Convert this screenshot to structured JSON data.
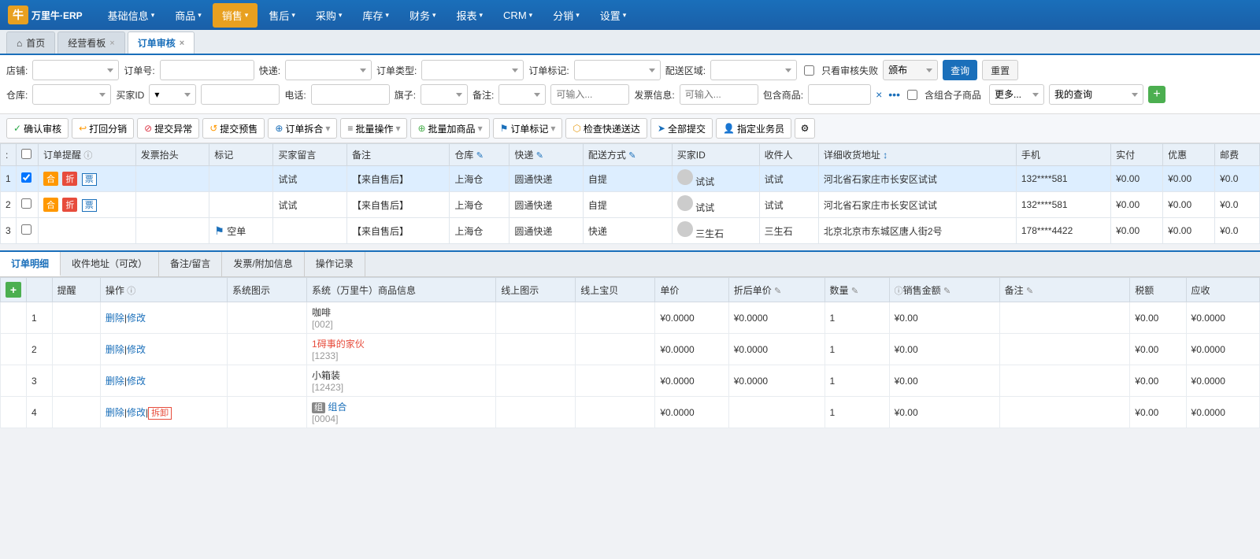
{
  "app": {
    "logo_text": "万里牛·ERP"
  },
  "nav": {
    "items": [
      {
        "label": "基础信息",
        "has_arrow": true,
        "active": false
      },
      {
        "label": "商品",
        "has_arrow": true,
        "active": false
      },
      {
        "label": "销售",
        "has_arrow": true,
        "active": true
      },
      {
        "label": "售后",
        "has_arrow": true,
        "active": false
      },
      {
        "label": "采购",
        "has_arrow": true,
        "active": false
      },
      {
        "label": "库存",
        "has_arrow": true,
        "active": false
      },
      {
        "label": "财务",
        "has_arrow": true,
        "active": false
      },
      {
        "label": "报表",
        "has_arrow": true,
        "active": false
      },
      {
        "label": "CRM",
        "has_arrow": true,
        "active": false
      },
      {
        "label": "分销",
        "has_arrow": true,
        "active": false
      },
      {
        "label": "设置",
        "has_arrow": true,
        "active": false
      }
    ]
  },
  "tabs": [
    {
      "label": "首页",
      "closable": false,
      "icon": "home"
    },
    {
      "label": "经营看板",
      "closable": true
    },
    {
      "label": "订单审核",
      "closable": true,
      "active": true
    }
  ],
  "filters": {
    "row1": {
      "store_label": "店铺:",
      "order_no_label": "订单号:",
      "express_label": "快递:",
      "order_type_label": "订单类型:",
      "order_mark_label": "订单标记:",
      "delivery_area_label": "配送区域:",
      "only_failed_label": "只看审核失败",
      "search_btn": "查询",
      "reset_btn": "重置"
    },
    "row2": {
      "warehouse_label": "仓库:",
      "buyer_id_label": "买家ID",
      "phone_label": "电话:",
      "flag_label": "旗子:",
      "note_label": "备注:",
      "note_placeholder": "可输入...",
      "invoice_label": "发票信息:",
      "invoice_placeholder": "可输入...",
      "include_goods_label": "包含商品:",
      "combined_child_label": "含组合子商品",
      "more_btn": "更多...",
      "my_query_label": "我的查询"
    }
  },
  "toolbar": {
    "confirm_btn": "确认审核",
    "return_btn": "打回分销",
    "exception_btn": "提交异常",
    "presale_btn": "提交预售",
    "merge_btn": "订单拆合",
    "batch_op_btn": "批量操作",
    "batch_add_btn": "批量加商品",
    "order_mark_btn": "订单标记",
    "check_express_btn": "检查快递送达",
    "submit_all_btn": "全部提交",
    "assign_btn": "指定业务员"
  },
  "main_table": {
    "columns": [
      "",
      "✓",
      "订单提醒",
      "发票抬头",
      "标记",
      "买家留言",
      "备注",
      "仓库",
      "快递",
      "配送方式",
      "买家ID",
      "收件人",
      "详细收货地址",
      "手机",
      "实付",
      "优惠",
      "邮费"
    ],
    "rows": [
      {
        "seq": "1",
        "checked": true,
        "tags": [
          "合",
          "折",
          "票"
        ],
        "invoice": "",
        "mark": "",
        "buyer_msg": "试试",
        "note": "【来自售后】",
        "warehouse": "上海仓",
        "express": "圆通快递",
        "delivery": "自提",
        "buyer_id": "试试",
        "receiver": "试试",
        "address": "河北省石家庄市长安区试试",
        "mobile": "132****581",
        "paid": "¥0.00",
        "discount": "¥0.00",
        "postage": "¥0.0",
        "selected": true
      },
      {
        "seq": "2",
        "checked": false,
        "tags": [
          "合",
          "折",
          "票"
        ],
        "invoice": "",
        "mark": "",
        "buyer_msg": "试试",
        "note": "【来自售后】",
        "warehouse": "上海仓",
        "express": "圆通快递",
        "delivery": "自提",
        "buyer_id": "试试",
        "receiver": "试试",
        "address": "河北省石家庄市长安区试试",
        "mobile": "132****581",
        "paid": "¥0.00",
        "discount": "¥0.00",
        "postage": "¥0.0",
        "selected": false
      },
      {
        "seq": "3",
        "checked": false,
        "tags": [],
        "invoice": "",
        "mark": "空单",
        "mark_flag": "bookmark",
        "buyer_msg": "",
        "note": "【来自售后】",
        "warehouse": "上海仓",
        "express": "圆通快递",
        "delivery": "快递",
        "buyer_id": "三生石",
        "receiver": "三生石",
        "address": "北京北京市东城区唐人街2号",
        "mobile": "178****4422",
        "paid": "¥0.00",
        "discount": "¥0.00",
        "postage": "¥0.0",
        "selected": false
      }
    ]
  },
  "bottom_panel": {
    "tabs": [
      "订单明细",
      "收件地址（可改）",
      "备注/留言",
      "发票/附加信息",
      "操作记录"
    ],
    "active_tab": "订单明细",
    "detail_columns": [
      "",
      "提醒",
      "操作",
      "系统图示",
      "系统（万里牛）商品信息",
      "线上图示",
      "线上宝贝",
      "单价",
      "折后单价",
      "数量",
      "销售金额",
      "备注",
      "税额",
      "应收"
    ],
    "detail_rows": [
      {
        "seq": "1",
        "reminder": "",
        "ops": "删除|修改",
        "system_img": "",
        "product_name": "咖啡",
        "product_code": "[002]",
        "product_name_color": "normal",
        "online_img": "",
        "online_product": "",
        "unit_price": "¥0.0000",
        "discounted_price": "¥0.0000",
        "quantity": "1",
        "sales_amount": "¥0.00",
        "note": "",
        "tax": "¥0.00",
        "receivable": "¥0.0000"
      },
      {
        "seq": "2",
        "reminder": "",
        "ops": "删除|修改",
        "system_img": "",
        "product_name": "1碍事的家伙",
        "product_code": "[1233]",
        "product_name_color": "red",
        "online_img": "",
        "online_product": "",
        "unit_price": "¥0.0000",
        "discounted_price": "¥0.0000",
        "quantity": "1",
        "sales_amount": "¥0.00",
        "note": "",
        "tax": "¥0.00",
        "receivable": "¥0.0000"
      },
      {
        "seq": "3",
        "reminder": "",
        "ops": "删除|修改",
        "system_img": "",
        "product_name": "小箱装",
        "product_code": "[12423]",
        "product_name_color": "normal",
        "online_img": "",
        "online_product": "",
        "unit_price": "¥0.0000",
        "discounted_price": "¥0.0000",
        "quantity": "1",
        "sales_amount": "¥0.00",
        "note": "",
        "tax": "¥0.00",
        "receivable": "¥0.0000"
      },
      {
        "seq": "4",
        "reminder": "",
        "ops": "删除|修改|拆卸",
        "system_img": "",
        "product_name": "组合",
        "product_name_prefix": "组",
        "product_code": "[0004]",
        "product_name_color": "blue",
        "online_img": "",
        "online_product": "",
        "unit_price": "¥0.0000",
        "discounted_price": "",
        "quantity": "1",
        "sales_amount": "¥0.00",
        "note": "",
        "tax": "¥0.00",
        "receivable": "¥0.0000"
      }
    ]
  }
}
